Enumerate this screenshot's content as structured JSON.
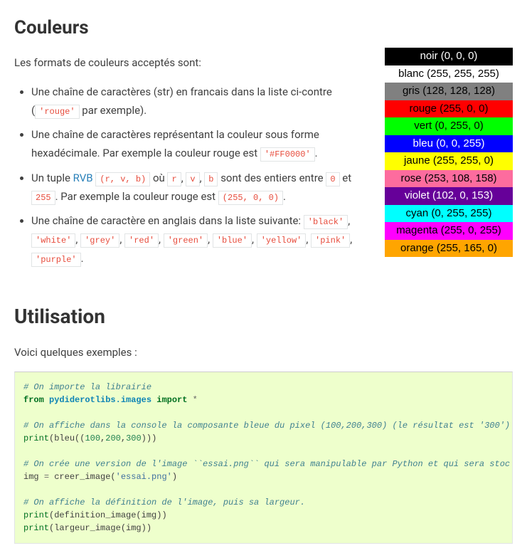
{
  "heading_colors": "Couleurs",
  "intro_colors": "Les formats de couleurs acceptés sont:",
  "bullets": {
    "b1_a": "Une chaîne de caractères (str) en francais dans la liste ci-contre (",
    "b1_code": "'rouge'",
    "b1_b": " par exemple).",
    "b2_a": "Une chaîne de caractères représentant la couleur sous forme hexadécimale. Par exemple la couleur rouge est ",
    "b2_code": "'#FF0000'",
    "b2_b": ".",
    "b3_a": "Un tuple ",
    "b3_link": "RVB",
    "b3_code1": "(r, v, b)",
    "b3_b": " où ",
    "b3_r": "r",
    "b3_v": "v",
    "b3_bb": "b",
    "b3_c": " sont des entiers entre ",
    "b3_zero": "0",
    "b3_d": " et ",
    "b3_255": "255",
    "b3_e": ". Par exemple la couleur rouge est ",
    "b3_tuple": "(255, 0, 0)",
    "b3_f": ".",
    "b4_a": "Une chaîne de caractère en anglais dans la liste suivante: ",
    "b4_codes": [
      "'black'",
      "'white'",
      "'grey'",
      "'red'",
      "'green'",
      "'blue'",
      "'yellow'",
      "'pink'",
      "'purple'"
    ],
    "b4_sep": ", ",
    "b4_end": "."
  },
  "color_table": [
    {
      "label": "noir (0, 0, 0)",
      "bg": "#000000",
      "fg": "#ffffff"
    },
    {
      "label": "blanc (255, 255, 255)",
      "bg": "#ffffff",
      "fg": "#000000"
    },
    {
      "label": "gris (128, 128, 128)",
      "bg": "#808080",
      "fg": "#000000"
    },
    {
      "label": "rouge (255, 0, 0)",
      "bg": "#ff0000",
      "fg": "#000000"
    },
    {
      "label": "vert (0, 255, 0)",
      "bg": "#00ff00",
      "fg": "#000000"
    },
    {
      "label": "bleu (0, 0, 255)",
      "bg": "#0000ff",
      "fg": "#ffffff"
    },
    {
      "label": "jaune (255, 255, 0)",
      "bg": "#ffff00",
      "fg": "#000000"
    },
    {
      "label": "rose (253, 108, 158)",
      "bg": "#fd6c9e",
      "fg": "#000000"
    },
    {
      "label": "violet (102, 0, 153)",
      "bg": "#660099",
      "fg": "#ffffff"
    },
    {
      "label": "cyan (0, 255, 255)",
      "bg": "#00ffff",
      "fg": "#000000"
    },
    {
      "label": "magenta (255, 0, 255)",
      "bg": "#ff00ff",
      "fg": "#000000"
    },
    {
      "label": "orange (255, 165, 0)",
      "bg": "#ffa500",
      "fg": "#000000"
    }
  ],
  "heading_usage": "Utilisation",
  "intro_usage": "Voici quelques exemples :",
  "code": {
    "c1": "# On importe la librairie",
    "l1_from": "from",
    "l1_mod": "pydiderotlibs.images",
    "l1_import": "import",
    "l1_star": "*",
    "c2": "# On affiche dans la console la composante bleue du pixel (100,200,300) (le résultat est '300')",
    "l2_print": "print",
    "l2_a": "(bleu((",
    "l2_n1": "100",
    "l2_n2": "200",
    "l2_n3": "300",
    "l2_b": ")))",
    "c3": "# On crée une version de l'image ``essai.png`` qui sera manipulable par Python et qui sera stoc",
    "l3_a": "img ",
    "l3_eq": "=",
    "l3_b": " creer_image(",
    "l3_s": "'essai.png'",
    "l3_c": ")",
    "c4": "# On affiche la définition de l'image, puis sa largeur.",
    "l4_print": "print",
    "l4_a": "(definition_image(img))",
    "l5_print": "print",
    "l5_a": "(largeur_image(img))"
  }
}
